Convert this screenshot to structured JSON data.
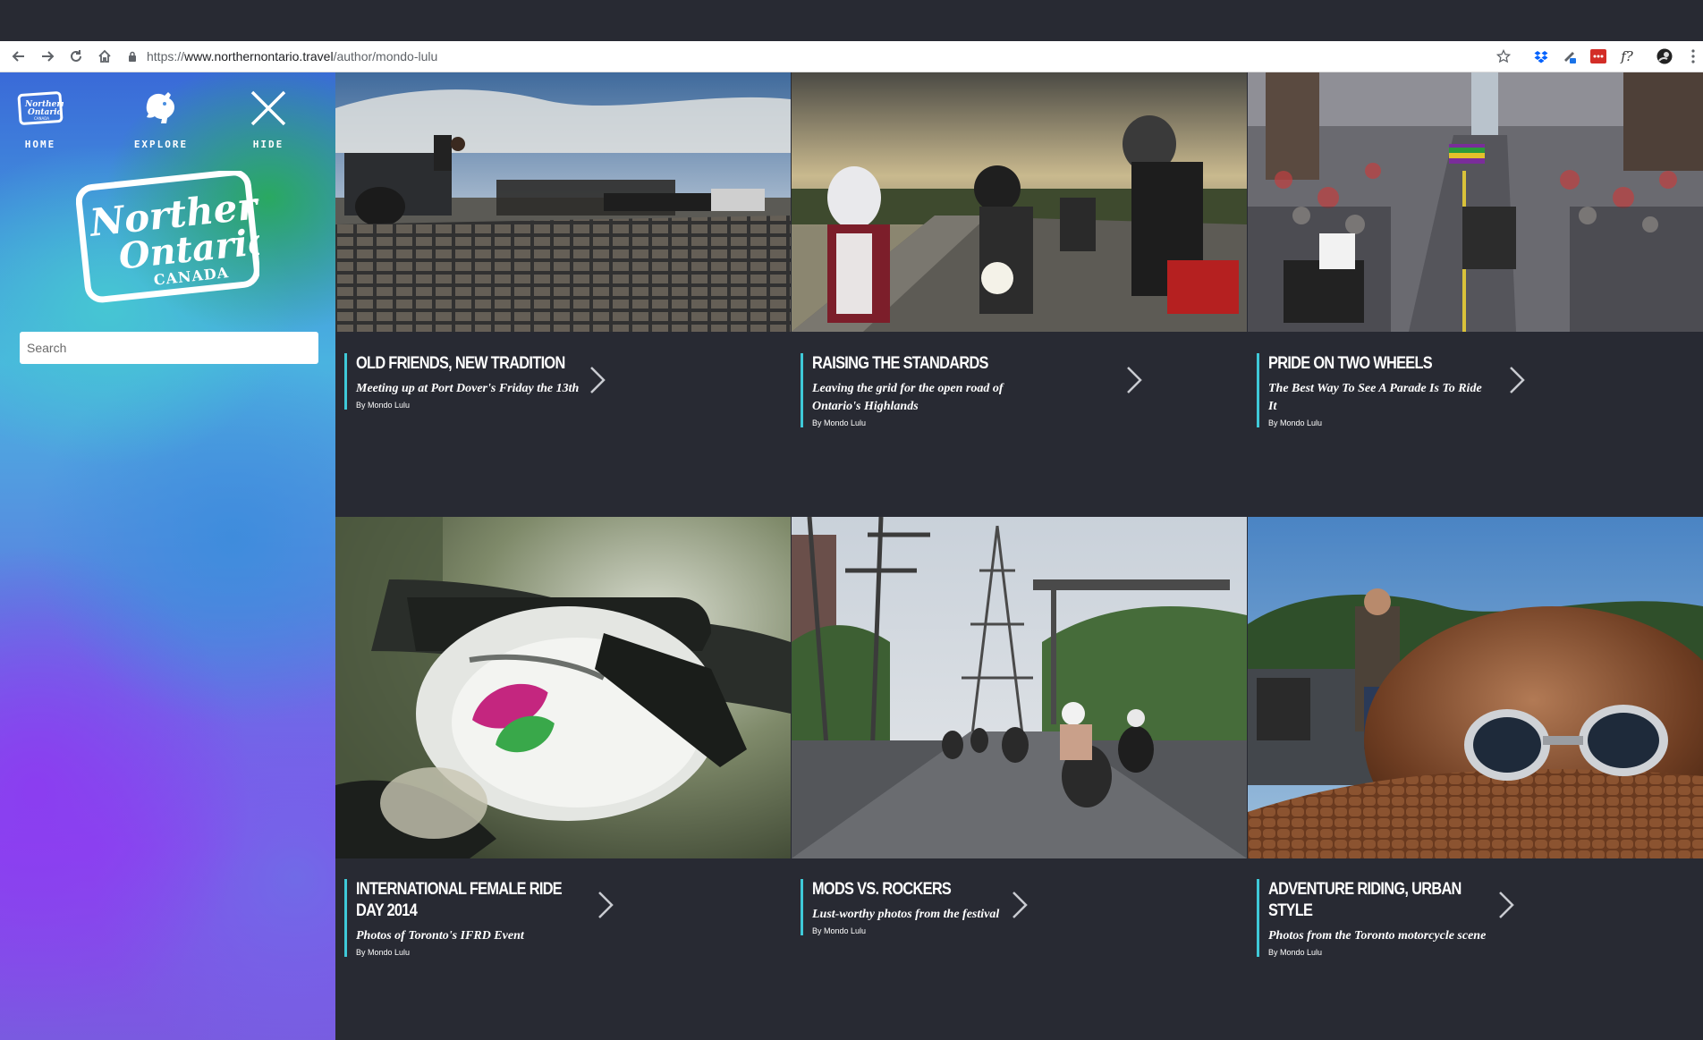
{
  "browser": {
    "url_scheme": "https://",
    "url_host": "www.northernontario.travel",
    "url_path": "/author/mondo-lulu",
    "icons": [
      "back-icon",
      "forward-icon",
      "reload-icon",
      "home-icon",
      "lock-icon",
      "star-icon",
      "dropbox-icon",
      "extension-icon",
      "lastpass-icon",
      "font-icon",
      "profile-icon",
      "menu-icon"
    ],
    "ext_font_label": "f?"
  },
  "sidebar": {
    "nav": [
      {
        "label": "HOME",
        "icon": "northern-ontario-mini-logo"
      },
      {
        "label": "EXPLORE",
        "icon": "moose-icon"
      },
      {
        "label": "HIDE",
        "icon": "close-icon"
      }
    ],
    "logo_text": {
      "line1": "Northern",
      "line2": "Ontario",
      "line3": "CANADA",
      "mini_line3": "CANADA"
    },
    "search_placeholder": "Search"
  },
  "cards": [
    {
      "title": "Old Friends, New Tradition",
      "subtitle": "Meeting up at Port Dover's Friday the 13th",
      "byline": "By Mondo Lulu"
    },
    {
      "title": "Raising the Standards",
      "subtitle": "Leaving the grid for the open road of Ontario's Highlands",
      "byline": "By Mondo Lulu"
    },
    {
      "title": "Pride on Two Wheels",
      "subtitle": "The Best Way To See A Parade Is To Ride It",
      "byline": "By Mondo Lulu"
    },
    {
      "title": "International Female Ride Day 2014",
      "subtitle": "Photos of Toronto's IFRD Event",
      "byline": "By Mondo Lulu"
    },
    {
      "title": "Mods vs. Rockers",
      "subtitle": "Lust-worthy photos from the festival",
      "byline": "By Mondo Lulu"
    },
    {
      "title": "Adventure Riding, Urban Style",
      "subtitle": "Photos from the Toronto motorcycle scene",
      "byline": "By Mondo Lulu"
    }
  ],
  "colors": {
    "page_bg": "#282a33",
    "accent": "#3fc9d8",
    "text": "#ffffff"
  }
}
